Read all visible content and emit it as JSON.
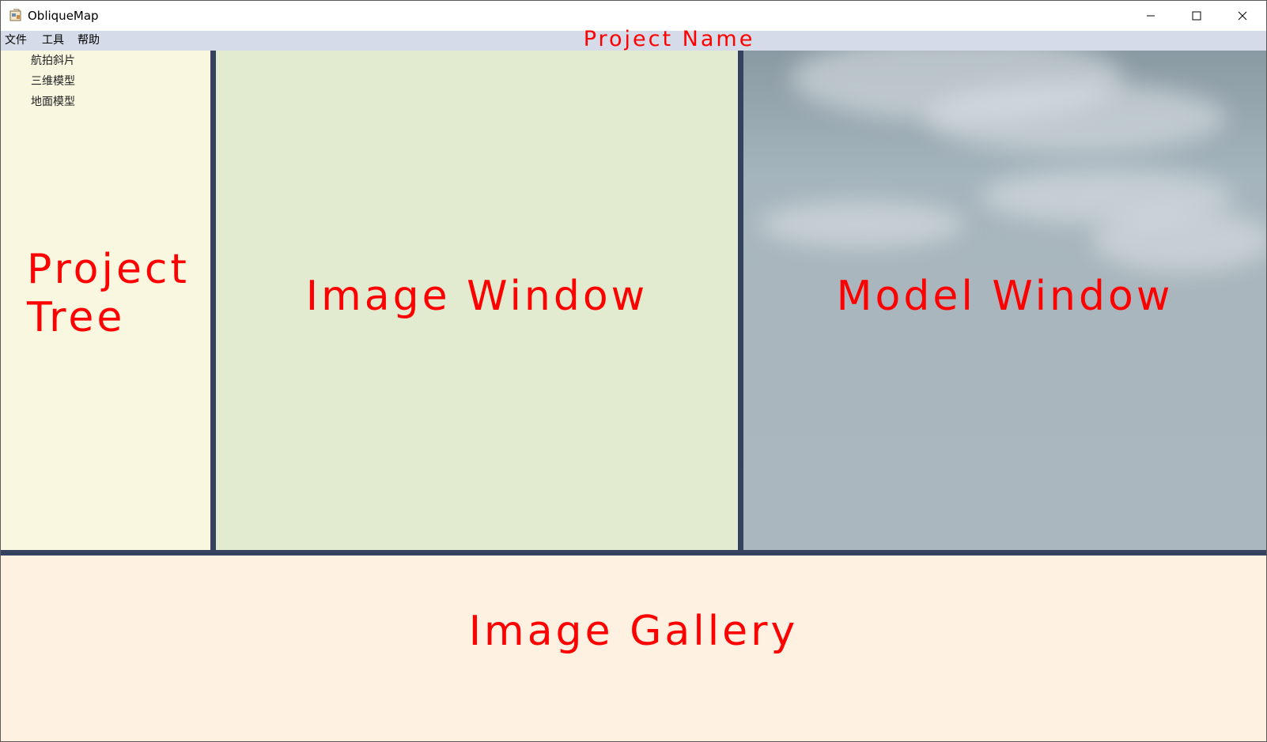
{
  "window": {
    "title": "ObliqueMap",
    "icon": "app-icon",
    "controls": {
      "minimize": "minimize-icon",
      "maximize": "maximize-icon",
      "close": "close-icon"
    }
  },
  "menu": {
    "items": [
      {
        "label": "文件"
      },
      {
        "label": "工具"
      },
      {
        "label": "帮助"
      }
    ],
    "project_name": "Project Name"
  },
  "project_tree": {
    "items": [
      {
        "label": "航拍斜片"
      },
      {
        "label": "三维模型"
      },
      {
        "label": "地面模型"
      }
    ],
    "label_line1": "Project",
    "label_line2": "Tree"
  },
  "image_window": {
    "label": "Image Window"
  },
  "model_window": {
    "label": "Model Window"
  },
  "image_gallery": {
    "label": "Image Gallery"
  },
  "colors": {
    "splitter": "#34425f",
    "menu_bg": "#d5dbe8",
    "tree_bg": "#f9f7e0",
    "image_bg": "#e2ebcf",
    "model_bg": "#a9b6bd",
    "gallery_bg": "#fef1e1",
    "annotation": "#ff0000"
  }
}
